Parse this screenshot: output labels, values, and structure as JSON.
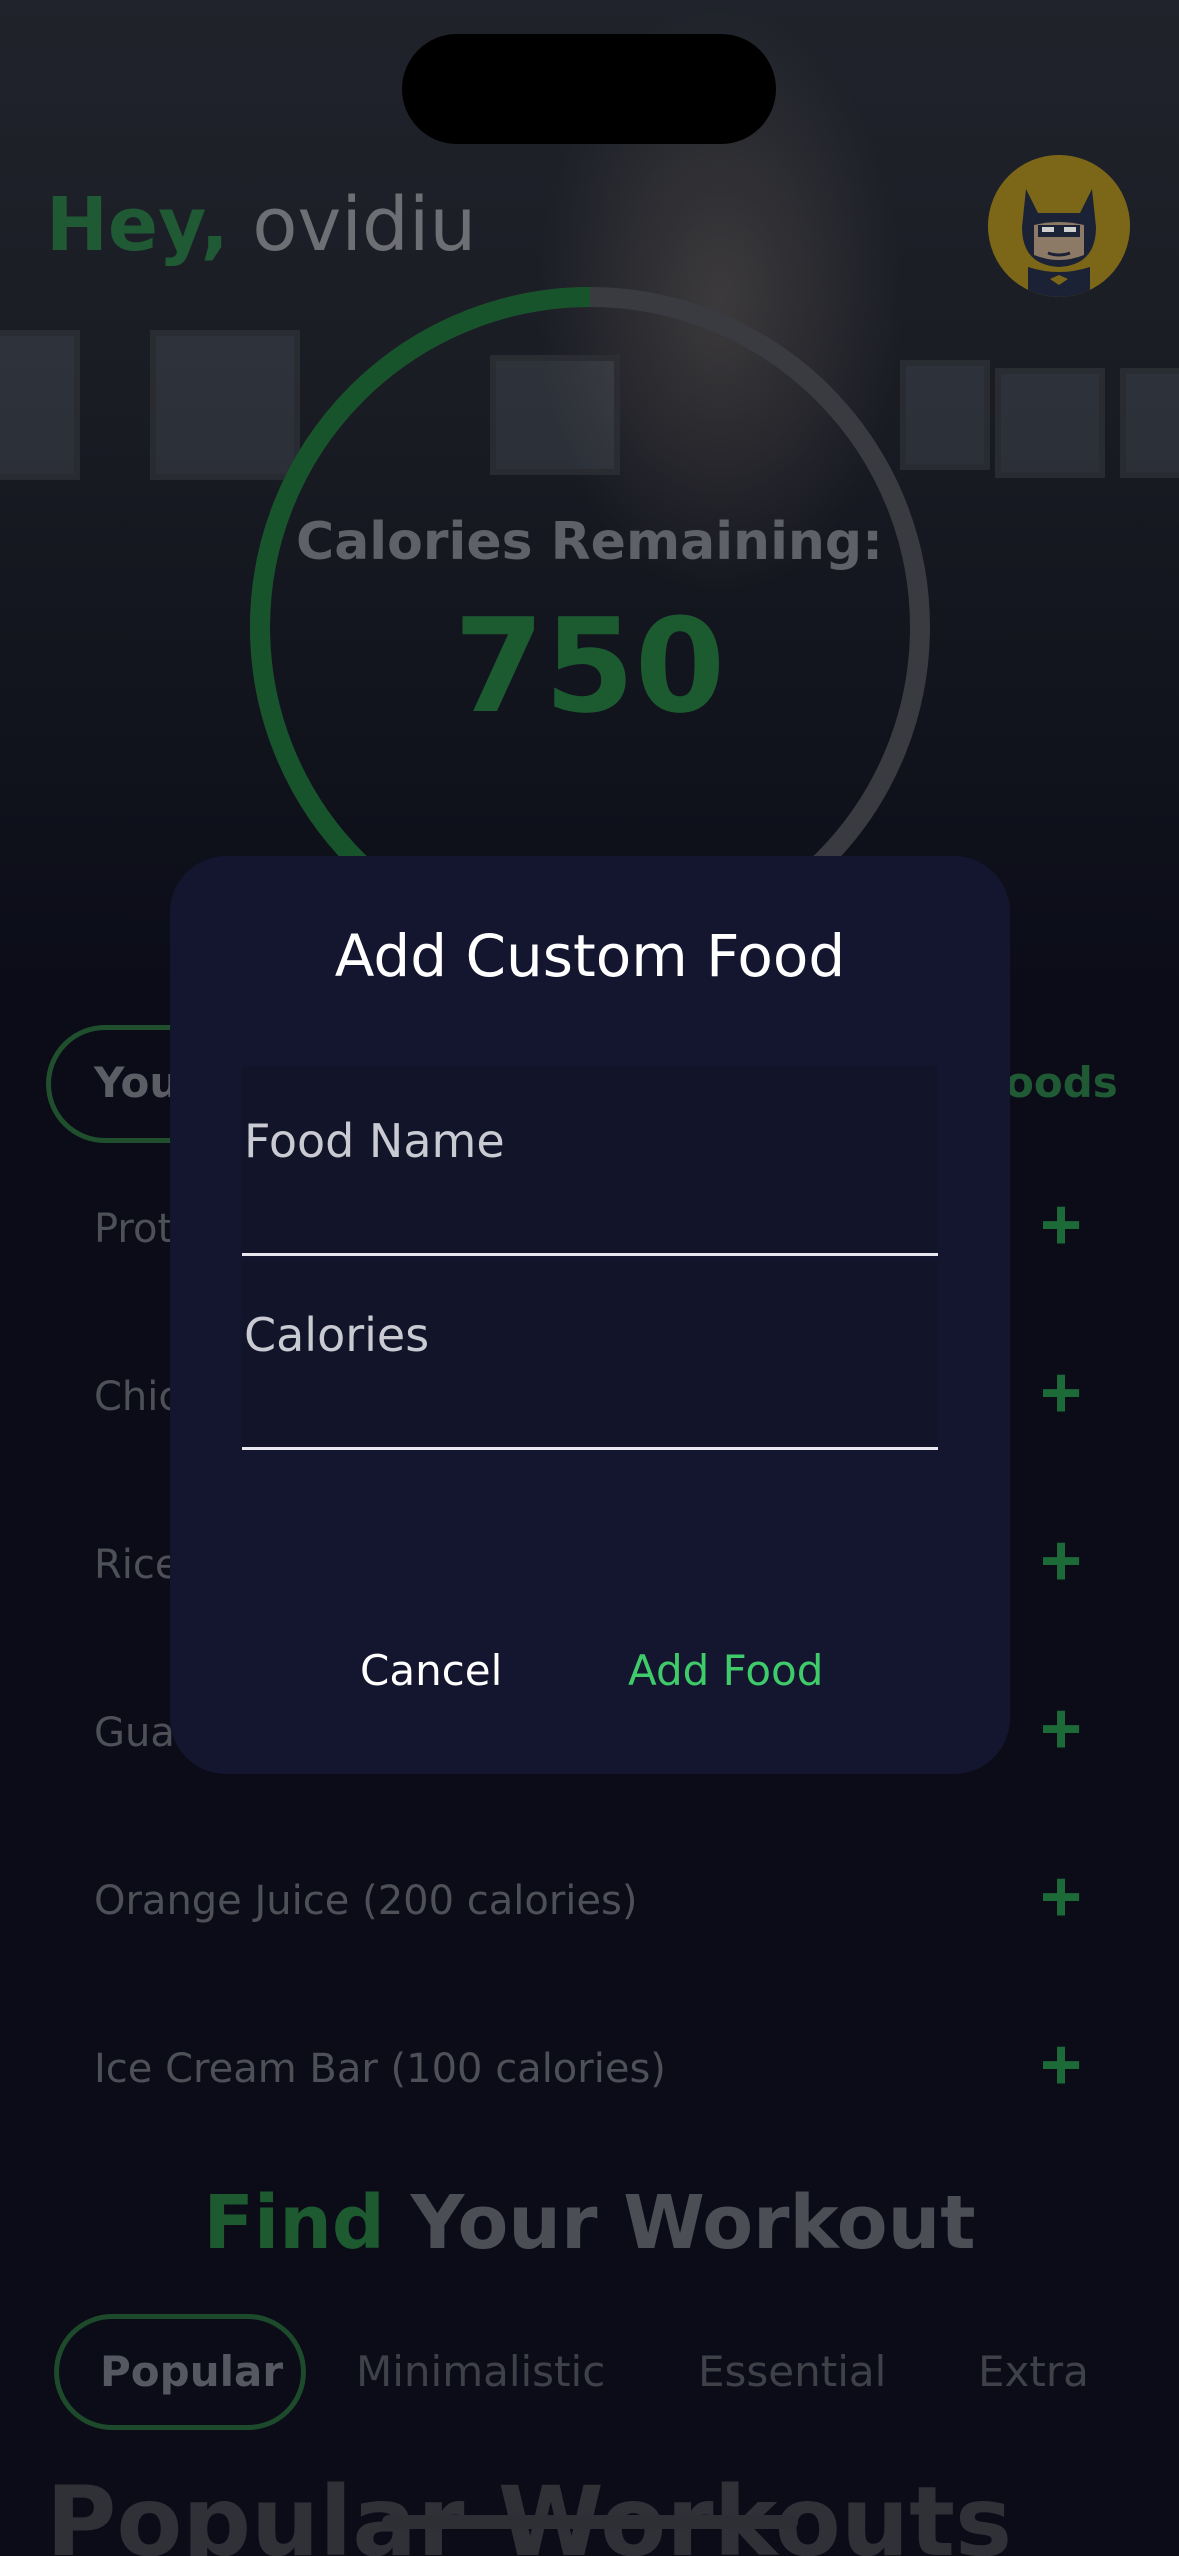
{
  "header": {
    "greeting_prefix": "Hey,",
    "user_name": "ovidiu"
  },
  "calories": {
    "label": "Calories Remaining:",
    "value": "750",
    "progress_fraction": 0.55
  },
  "food_tabs": {
    "active_partial": "You",
    "other_partial": "oods"
  },
  "food_list": [
    {
      "label": "Prot"
    },
    {
      "label": "Chic"
    },
    {
      "label": "Rice"
    },
    {
      "label": "Gua"
    },
    {
      "label": "Orange Juice (200 calories)"
    },
    {
      "label": "Ice Cream Bar (100 calories)"
    }
  ],
  "workout": {
    "title_accent": "Find",
    "title_rest": " Your Workout",
    "tabs": [
      "Popular",
      "Minimalistic",
      "Essential",
      "Extra"
    ],
    "section_title": "Popular Workouts"
  },
  "dialog": {
    "title": "Add Custom Food",
    "food_name_placeholder": "Food Name",
    "calories_placeholder": "Calories",
    "cancel_label": "Cancel",
    "add_label": "Add Food"
  },
  "colors": {
    "accent": "#3fcb6a",
    "dialog_bg": "#141630",
    "page_bg": "#0b0c18"
  },
  "icons": {
    "add_row": "plus-icon",
    "avatar": "batman-avatar"
  }
}
